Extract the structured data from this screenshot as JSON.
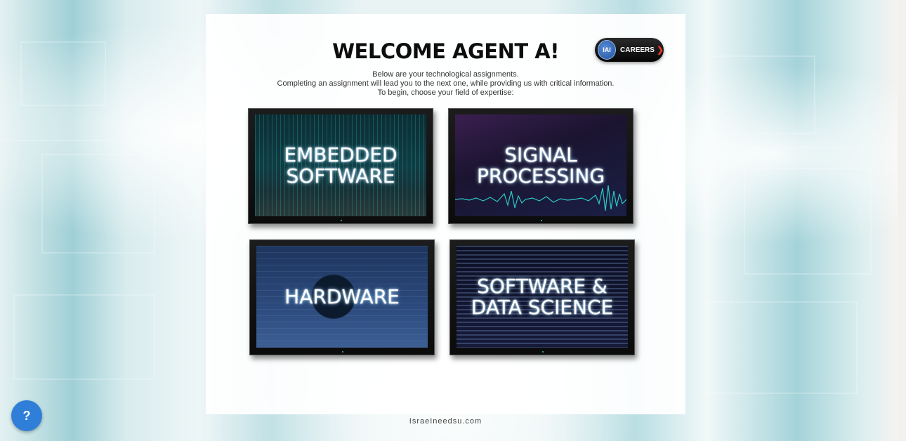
{
  "page": {
    "title": "WELCOME AGENT A!",
    "intro_lines": [
      "Below are your technological assignments.",
      "Completing an assignment will lead you to the next one, while providing us with critical information.",
      "To begin, choose your field of expertise:"
    ]
  },
  "careers": {
    "label": "CAREERS",
    "logo_text": "IAI",
    "chevron": "❯"
  },
  "tiles": [
    {
      "label_line1": "EMBEDDED",
      "label_line2": "SOFTWARE"
    },
    {
      "label_line1": "SIGNAL",
      "label_line2": "PROCESSING"
    },
    {
      "label_line1": "HARDWARE",
      "label_line2": ""
    },
    {
      "label_line1": "SOFTWARE &",
      "label_line2": "DATA SCIENCE"
    }
  ],
  "footer": {
    "text": "IsraeIneedsu.com"
  },
  "help": {
    "label": "?"
  },
  "colors": {
    "help_button": "#2f7fd8",
    "careers_chevron": "#e03a2a",
    "panel": "#ffffff"
  },
  "icons": {
    "careers_logo": "company-logo-icon",
    "help": "question-mark-icon"
  }
}
